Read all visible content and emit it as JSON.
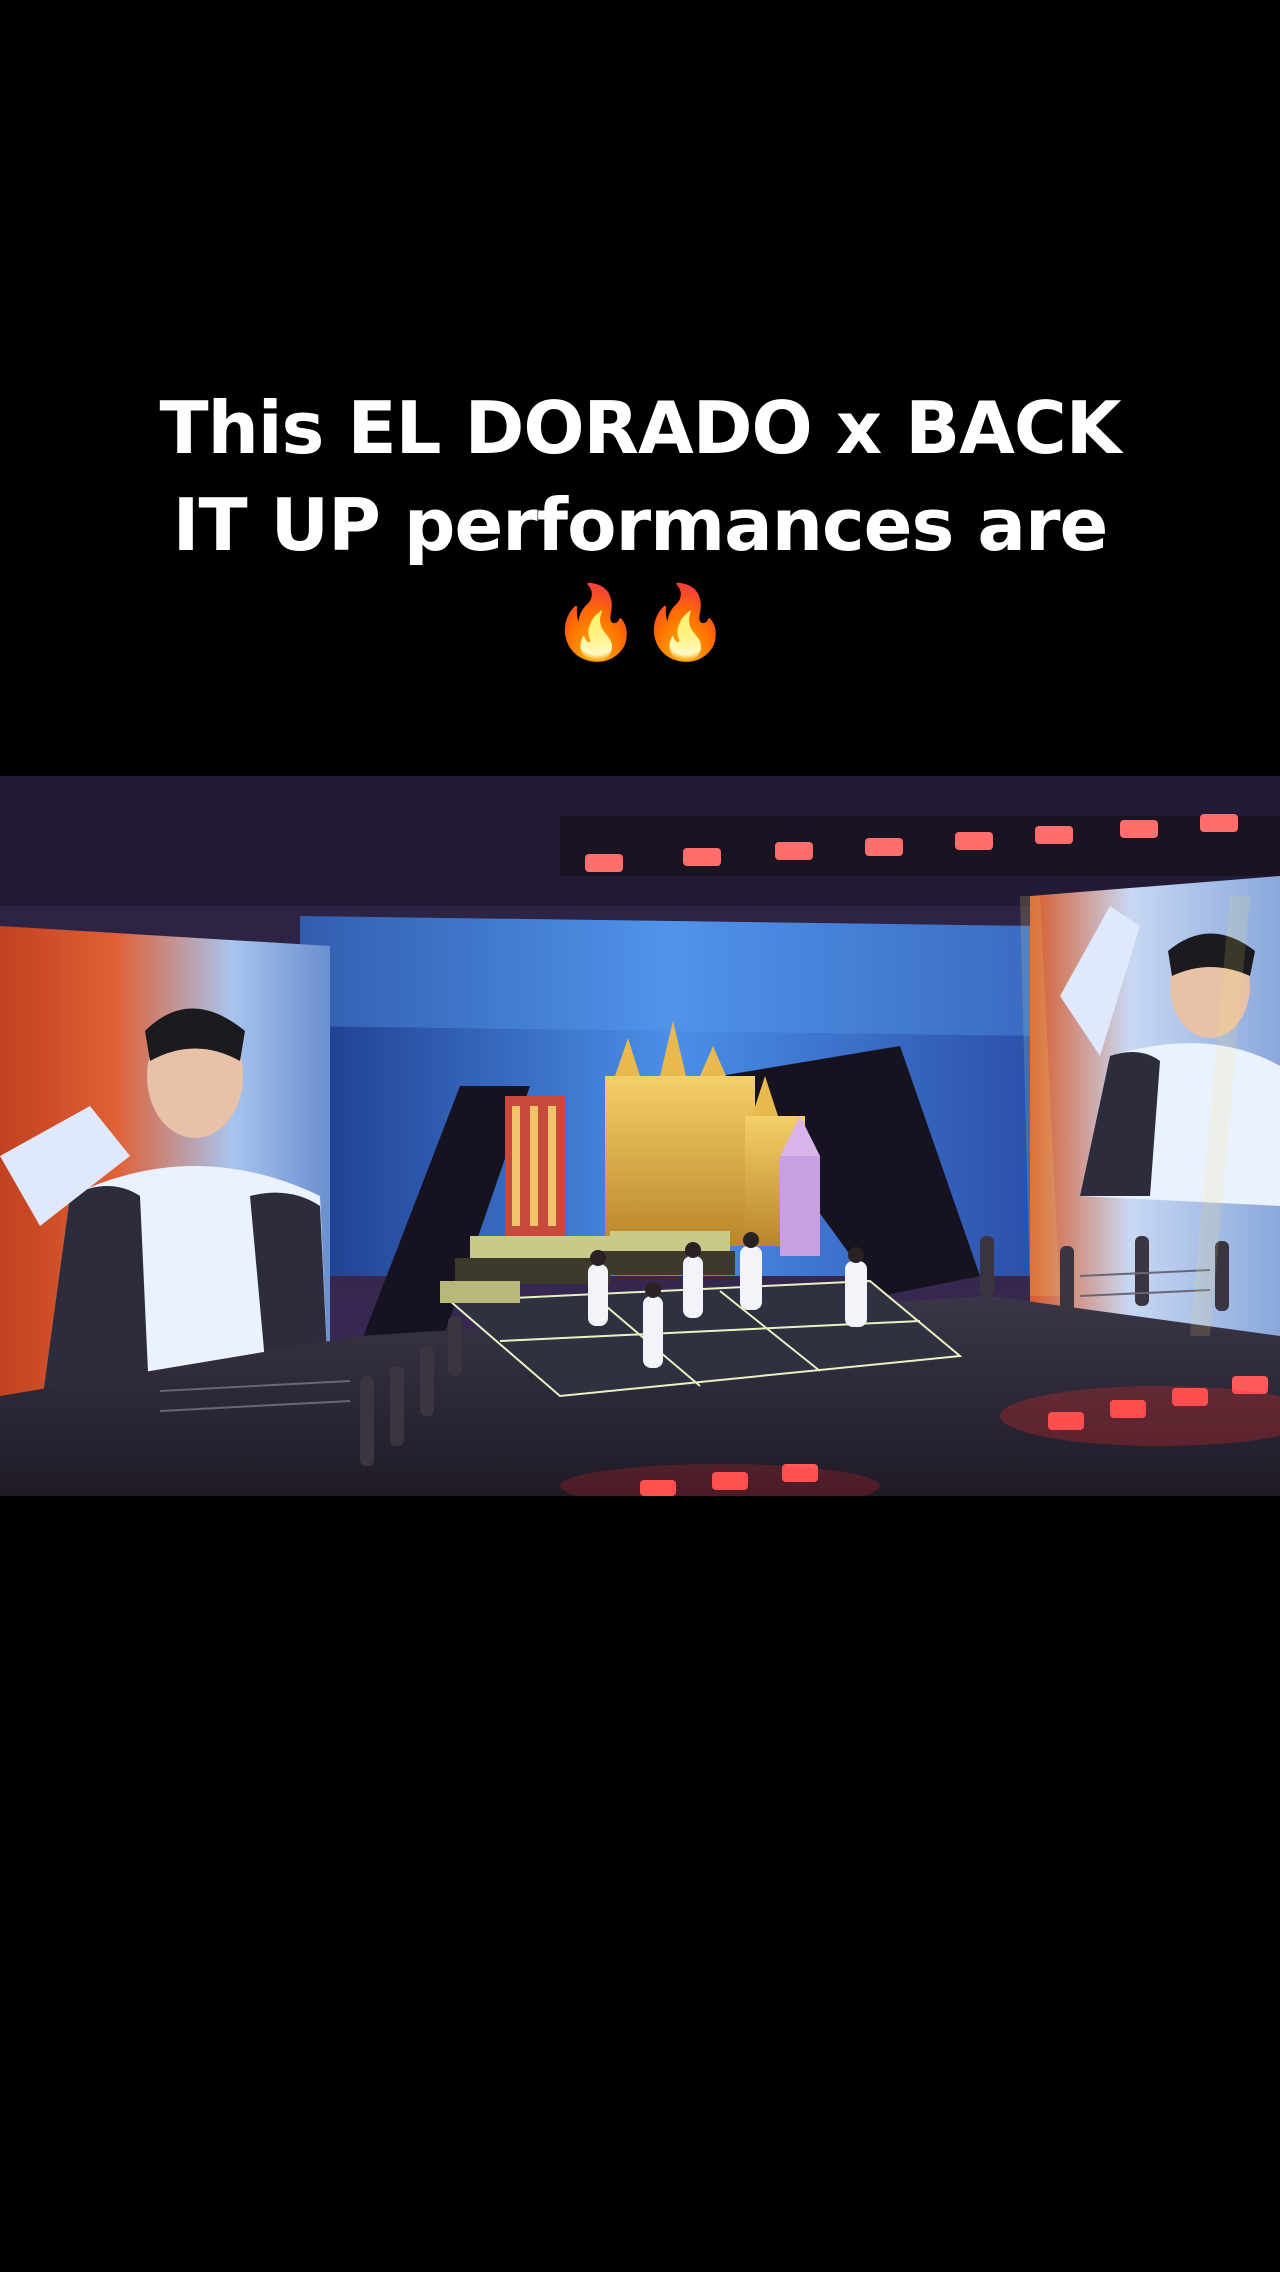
{
  "caption": {
    "text": "This EL DORADO x BACK IT UP performances are 🔥🔥"
  },
  "video": {
    "scene_description_icons": [
      "concert-stage",
      "led-screen-left",
      "led-screen-right",
      "castle-set",
      "performers"
    ],
    "colors": {
      "background": "#000000",
      "caption_text": "#ffffff",
      "stage_lights": "#ff3b3b",
      "screen_blue": "#3a6fd8",
      "castle_gold": "#e0b040"
    }
  }
}
